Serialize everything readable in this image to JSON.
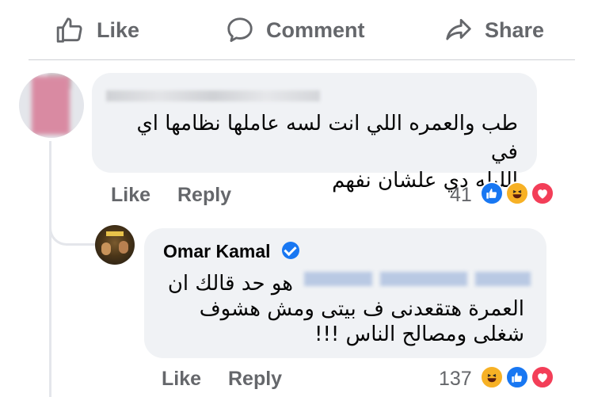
{
  "actions": {
    "like_label": "Like",
    "comment_label": "Comment",
    "share_label": "Share"
  },
  "comment_1": {
    "text_line_1": "طب والعمره اللي انت لسه عاملها نظامها اي في",
    "text_line_2": "الليله دي علشان نفهم",
    "like_label": "Like",
    "reply_label": "Reply",
    "reaction_count": "41",
    "reactions": [
      "like-icon",
      "haha-icon",
      "love-icon"
    ]
  },
  "comment_2": {
    "author": "Omar Kamal",
    "verified": true,
    "text_line_1": "هو حد قالك ان",
    "text_line_2": "العمرة هتقعدنى ف بيتى ومش هشوف",
    "text_line_3": "شغلى ومصالح الناس !!!",
    "like_label": "Like",
    "reply_label": "Reply",
    "reaction_count": "137",
    "reactions": [
      "haha-icon",
      "like-icon",
      "love-icon"
    ]
  },
  "colors": {
    "meta_gray": "#65676b",
    "bubble": "#f0f2f5",
    "verified_blue": "#1877f2",
    "like_blue": "#1877f2",
    "haha_yellow": "#f7b125",
    "love_red": "#f33e58"
  }
}
